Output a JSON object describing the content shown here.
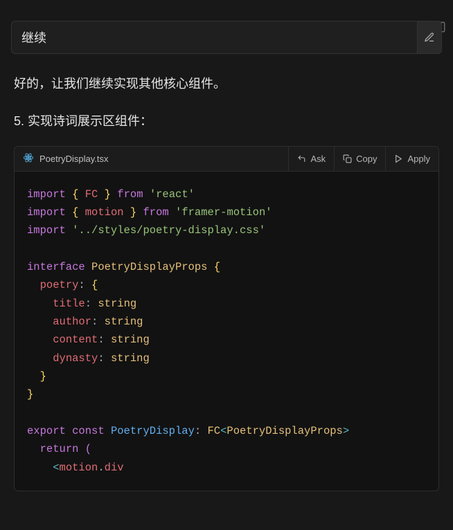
{
  "user_message": "继续",
  "assistant_intro": "好的，让我们继续实现其他核心组件。",
  "step_label": "5. 实现诗词展示区组件：",
  "code": {
    "filename": "PoetryDisplay.tsx",
    "actions": {
      "ask": "Ask",
      "copy": "Copy",
      "apply": "Apply"
    },
    "tokens": {
      "import": "import",
      "from": "from",
      "fc": "FC",
      "react": "'react'",
      "motion": "motion",
      "framer": "'framer-motion'",
      "csspath": "'../styles/poetry-display.css'",
      "interface": "interface",
      "props_type": "PoetryDisplayProps",
      "poetry": "poetry",
      "title": "title",
      "author": "author",
      "content": "content",
      "dynasty": "dynasty",
      "string": "string",
      "export": "export",
      "const": "const",
      "component": "PoetryDisplay",
      "return": "return",
      "motion_tag": "motion",
      "div": "div"
    }
  }
}
